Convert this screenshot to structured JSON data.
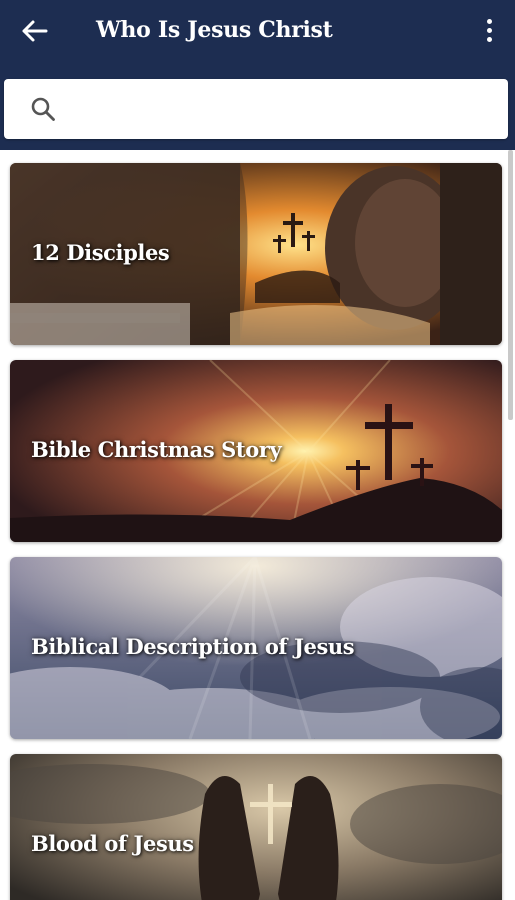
{
  "appbar": {
    "title": "Who Is Jesus Christ",
    "back_icon": "arrow-left-icon",
    "menu_icon": "more-vertical-icon",
    "color": "#1d2d51"
  },
  "search": {
    "icon": "search-icon",
    "value": "",
    "placeholder": ""
  },
  "cards": [
    {
      "label": "12 Disciples"
    },
    {
      "label": "Bible Christmas Story"
    },
    {
      "label": "Biblical Description of Jesus"
    },
    {
      "label": "Blood of Jesus"
    }
  ]
}
